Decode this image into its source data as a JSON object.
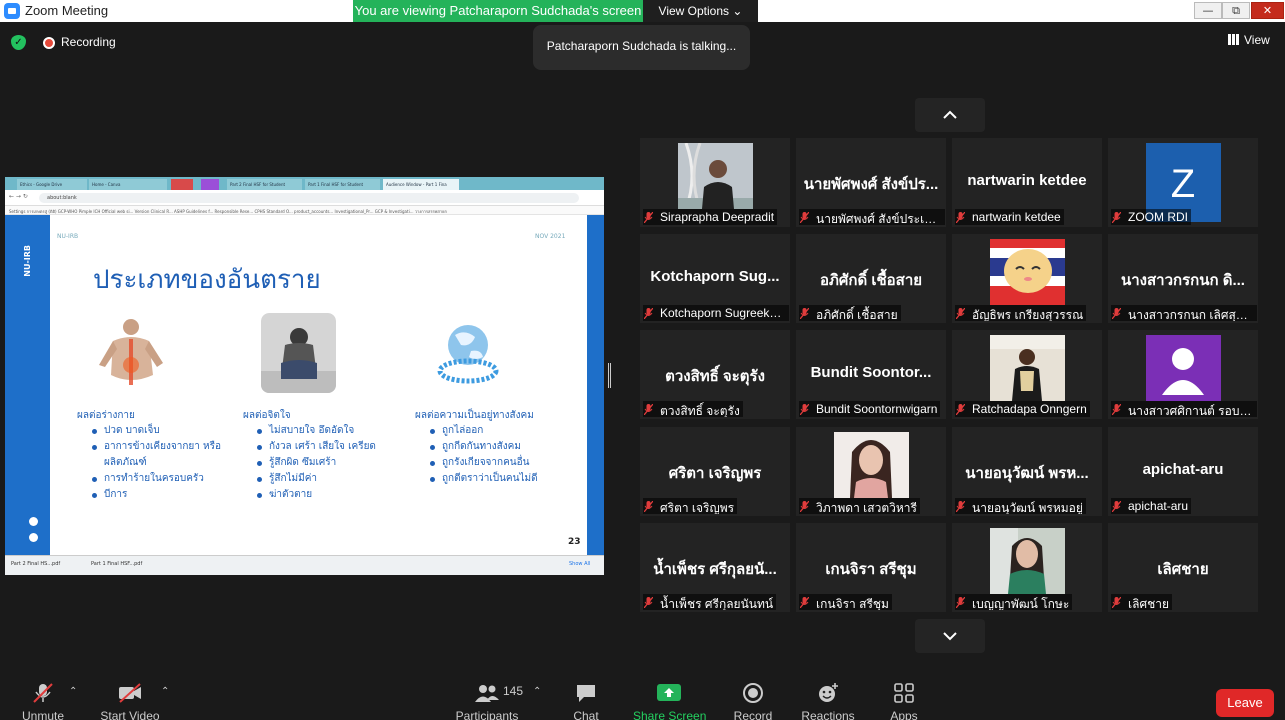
{
  "window": {
    "title": "Zoom Meeting"
  },
  "banner": {
    "viewing": "You are viewing Patcharaporn Sudchada's screen",
    "view_options": "View Options"
  },
  "status": {
    "recording": "Recording",
    "talking": "Patcharaporn Sudchada is talking...",
    "view": "View"
  },
  "browser": {
    "tabs": [
      "Ethics - Google Drive",
      "Home - Canva",
      "",
      "",
      "Part 2 Final HSF for Student",
      "Part 1 Final HSF for Student",
      "Audience Window - Part 1 Fina"
    ],
    "address": "about:blank",
    "bookmarks": "Settings   การเกษตรสู่ (ดิฮิ)   GCP-WHO Pimple   ICH Official web si...   Version Clinical R...   ASHP Guidelines f...   Responsible Rese...   CPHS Standard O...   product_accounts...   Investigational_Pr...   GCP & Investigati...   วางการสรรพสายก"
  },
  "slide": {
    "header_left": "NU-IRB",
    "header_right": "NOV 2021",
    "side_label": "NU-IRB",
    "title": "ประเภทของอันตราย",
    "columns": [
      {
        "heading": "ผลต่อร่างกาย",
        "items": [
          "ปวด บาดเจ็บ",
          "อาการข้างเคียงจากยา หรือผลิตภัณฑ์",
          "การทำร้ายในครอบครัว",
          "บีการ"
        ]
      },
      {
        "heading": "ผลต่อจิตใจ",
        "items": [
          "ไม่สบายใจ อึดอัดใจ",
          "กังวล เศร้า เสียใจ เครียด",
          "รู้สึกผิด ซึมเศร้า",
          "รู้สึกไม่มีค่า",
          "ฆ่าตัวตาย"
        ]
      },
      {
        "heading": "ผลต่อความเป็นอยู่ทางสังคม",
        "items": [
          "ถูกไล่ออก",
          "ถูกกีดกันทางสังคม",
          "ถูกรังเกียจจากคนอื่น",
          "ถูกตีตราว่าเป็นคนไม่ดี"
        ]
      }
    ],
    "page_number": "23"
  },
  "taskbar": {
    "item1": "Part 2 Final HS...pdf",
    "item2": "Part 1 Final HSF...pdf",
    "show_all": "Show All"
  },
  "participants_tiles": [
    {
      "big": "",
      "label": "Siraprapha Deepradit",
      "video": "dna"
    },
    {
      "big": "นายพัศพงศ์ สังข์ปร...",
      "label": "นายพัศพงศ์ สังข์ประเสริฐ",
      "video": ""
    },
    {
      "big": "nartwarin ketdee",
      "label": "nartwarin ketdee",
      "video": ""
    },
    {
      "big": "",
      "label": "ZOOM RDI",
      "video": "z"
    },
    {
      "big": "Kotchaporn Sug...",
      "label": "Kotchaporn Sugreeku...",
      "video": ""
    },
    {
      "big": "อภิศักดิ์ เชื้อสาย",
      "label": "อภิศักดิ์ เชื้อสาย",
      "video": ""
    },
    {
      "big": "",
      "label": "อัญธิพร เกรียงสุวรรณ",
      "video": "cartoon"
    },
    {
      "big": "นางสาวกรกนก ดิ...",
      "label": "นางสาวกรกนก เลิศสุภา...",
      "video": ""
    },
    {
      "big": "ตวงสิทธิ์ จะตุรัง",
      "label": "ตวงสิทธิ์ จะตุรัง",
      "video": ""
    },
    {
      "big": "Bundit Soontor...",
      "label": "Bundit Soontornwigarn",
      "video": ""
    },
    {
      "big": "",
      "label": "Ratchadapa Onngern",
      "video": "person1"
    },
    {
      "big": "",
      "label": "นางสาวศศิกานต์ รอบค...",
      "video": "avatar"
    },
    {
      "big": "ศริตา เจริญพร",
      "label": "ศริตา เจริญพร",
      "video": ""
    },
    {
      "big": "",
      "label": "วิภาพดา เสวตวิหารี",
      "video": "person2"
    },
    {
      "big": "นายอนุวัฒน์ พรห...",
      "label": "นายอนุวัฒน์ พรหมอยู่",
      "video": ""
    },
    {
      "big": "apichat-aru",
      "label": "apichat-aru",
      "video": ""
    },
    {
      "big": "น้ำเพ็ชร ศรีกุลยนั...",
      "label": "น้ำเพ็ชร ศรีกุลยนันทน์",
      "video": ""
    },
    {
      "big": "เกนจิรา สรีชุม",
      "label": "เกนจิรา สรีชุม",
      "video": ""
    },
    {
      "big": "",
      "label": "เบญญาพัฒน์ โกษะ",
      "video": "person3"
    },
    {
      "big": "เลิศชาย",
      "label": "เลิศชาย",
      "video": ""
    }
  ],
  "toolbar": {
    "unmute": "Unmute",
    "start_video": "Start Video",
    "participants": "Participants",
    "participants_count": "145",
    "chat": "Chat",
    "share_screen": "Share Screen",
    "record": "Record",
    "reactions": "Reactions",
    "apps": "Apps",
    "leave": "Leave"
  },
  "colors": {
    "accent_green": "#24b35a",
    "leave_red": "#e02828",
    "muted_red": "#e03c3c",
    "slide_blue": "#1e6fc9"
  }
}
